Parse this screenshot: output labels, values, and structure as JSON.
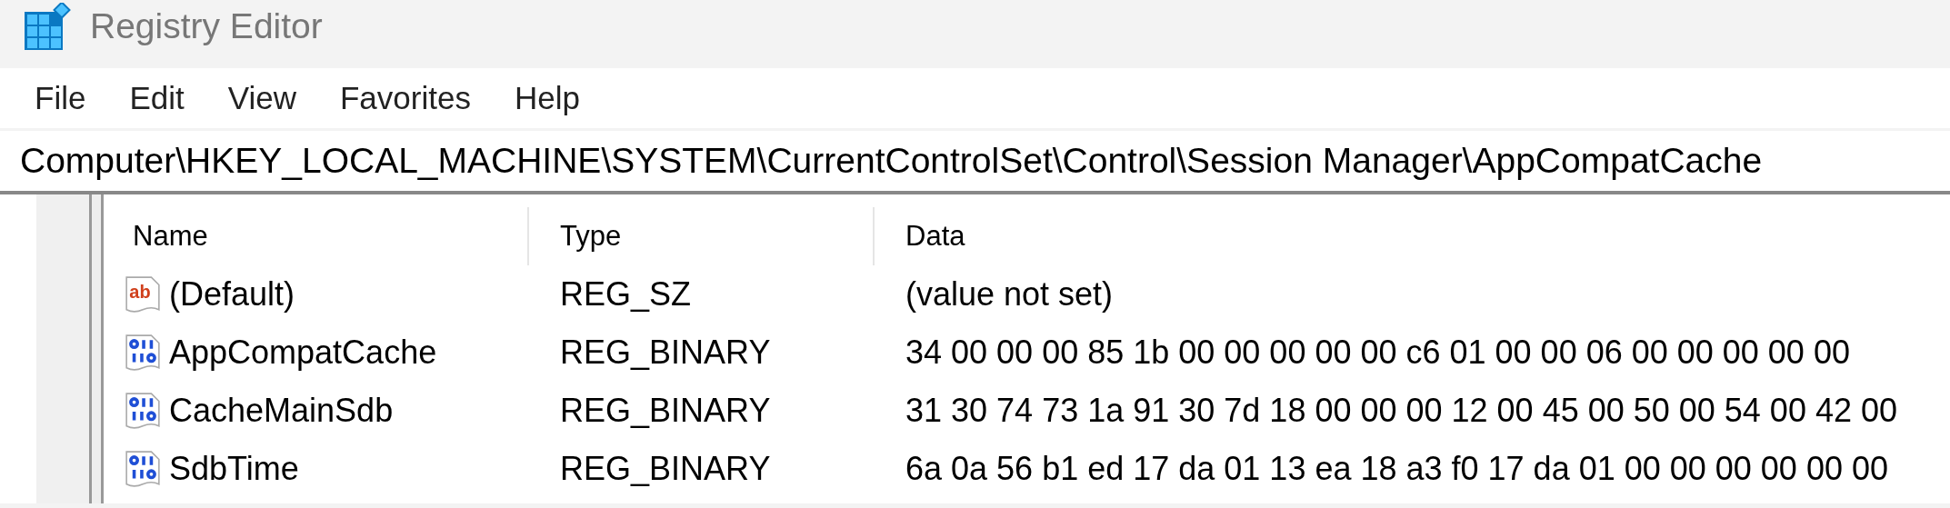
{
  "window": {
    "title": "Registry Editor"
  },
  "menu": [
    "File",
    "Edit",
    "View",
    "Favorites",
    "Help"
  ],
  "address": "Computer\\HKEY_LOCAL_MACHINE\\SYSTEM\\CurrentControlSet\\Control\\Session Manager\\AppCompatCache",
  "table": {
    "columns": [
      "Name",
      "Type",
      "Data"
    ],
    "rows": [
      {
        "kind": "string",
        "icon_text": "ab",
        "name": "(Default)",
        "type": "REG_SZ",
        "data": "(value not set)"
      },
      {
        "kind": "binary",
        "name": "AppCompatCache",
        "type": "REG_BINARY",
        "data": "34 00 00 00 85 1b 00 00 00 00 00 c6 01 00 00 06 00 00 00 00 00"
      },
      {
        "kind": "binary",
        "name": "CacheMainSdb",
        "type": "REG_BINARY",
        "data": "31 30 74 73 1a 91 30 7d 18 00 00 00 12 00 45 00 50 00 54 00 42 00"
      },
      {
        "kind": "binary",
        "name": "SdbTime",
        "type": "REG_BINARY",
        "data": "6a 0a 56 b1 ed 17 da 01 13 ea 18 a3 f0 17 da 01 00 00 00 00 00 00"
      }
    ]
  }
}
